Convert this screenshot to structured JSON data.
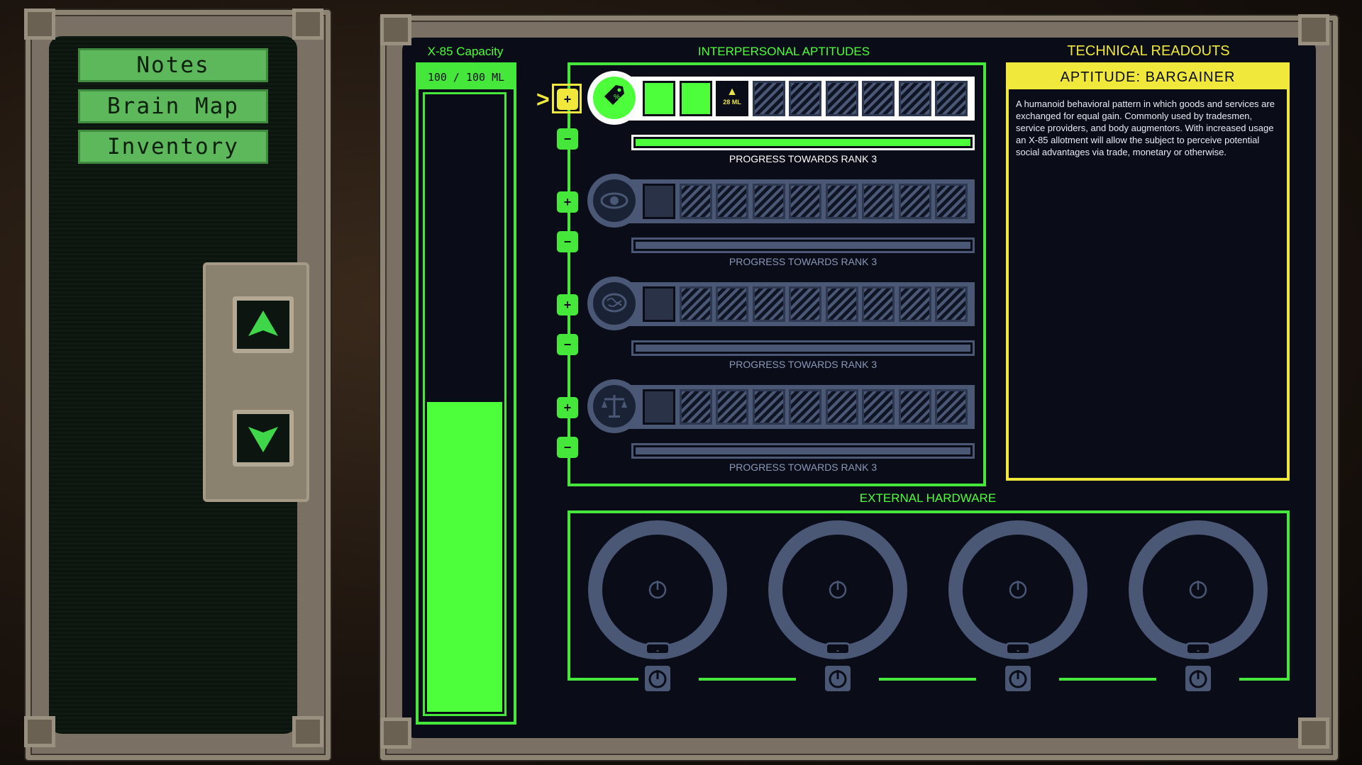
{
  "nav": {
    "notes": "Notes",
    "brain_map": "Brain Map",
    "inventory": "Inventory"
  },
  "capacity": {
    "title": "X-85 Capacity",
    "value": "100 / 100 ML",
    "fill_fraction": 0.5
  },
  "aptitudes": {
    "title": "INTERPERSONAL APTITUDES",
    "rows": [
      {
        "icon": "price-tag-icon",
        "filled_slots": 2,
        "cost": "28 ML",
        "progress": 1.0,
        "progress_label": "PROGRESS TOWARDS RANK 3",
        "selected": true
      },
      {
        "icon": "eye-icon",
        "filled_slots": 0,
        "progress": 0,
        "progress_label": "PROGRESS TOWARDS RANK 3",
        "selected": false
      },
      {
        "icon": "brain-icon",
        "filled_slots": 0,
        "progress": 0,
        "progress_label": "PROGRESS TOWARDS RANK 3",
        "selected": false
      },
      {
        "icon": "scales-icon",
        "filled_slots": 0,
        "progress": 0,
        "progress_label": "PROGRESS TOWARDS RANK 3",
        "selected": false
      }
    ]
  },
  "readouts": {
    "title": "TECHNICAL READOUTS",
    "heading": "APTITUDE: BARGAINER",
    "description": "A humanoid behavioral pattern in which goods and services are exchanged for equal gain. Commonly used by tradesmen, service providers, and body augmentors. With increased usage an X-85 allotment will allow the subject to perceive potential social advantages via trade, monetary or otherwise."
  },
  "hardware": {
    "title": "EXTERNAL HARDWARE",
    "slots": [
      "-",
      "-",
      "-",
      "-"
    ]
  },
  "colors": {
    "accent": "#4dff3a",
    "highlight": "#f0e83a",
    "inactive": "#4a5775",
    "panel_bg": "#0a0d18"
  }
}
